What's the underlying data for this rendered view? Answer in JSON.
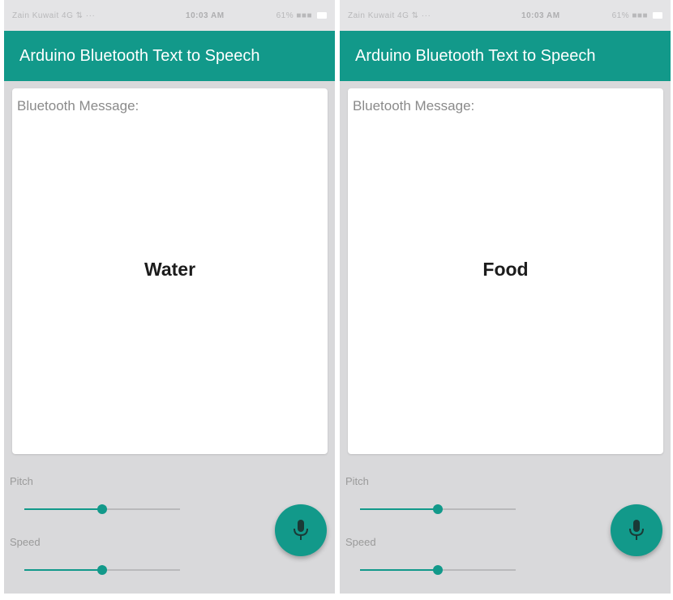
{
  "accent_color": "#12998a",
  "screens": [
    {
      "status": {
        "carrier": "Zain Kuwait 4G ⇅ ···",
        "time": "10:03 AM",
        "battery": "61% ■■■"
      },
      "app_title": "Arduino Bluetooth Text to Speech",
      "message_label": "Bluetooth Message:",
      "message": "Water",
      "pitch_label": "Pitch",
      "pitch_level": 0.5,
      "speed_label": "Speed",
      "speed_level": 0.5,
      "fab_icon": "microphone-icon"
    },
    {
      "status": {
        "carrier": "Zain Kuwait 4G ⇅ ···",
        "time": "10:03 AM",
        "battery": "61% ■■■"
      },
      "app_title": "Arduino Bluetooth Text to Speech",
      "message_label": "Bluetooth Message:",
      "message": "Food",
      "pitch_label": "Pitch",
      "pitch_level": 0.5,
      "speed_label": "Speed",
      "speed_level": 0.5,
      "fab_icon": "microphone-icon"
    }
  ]
}
